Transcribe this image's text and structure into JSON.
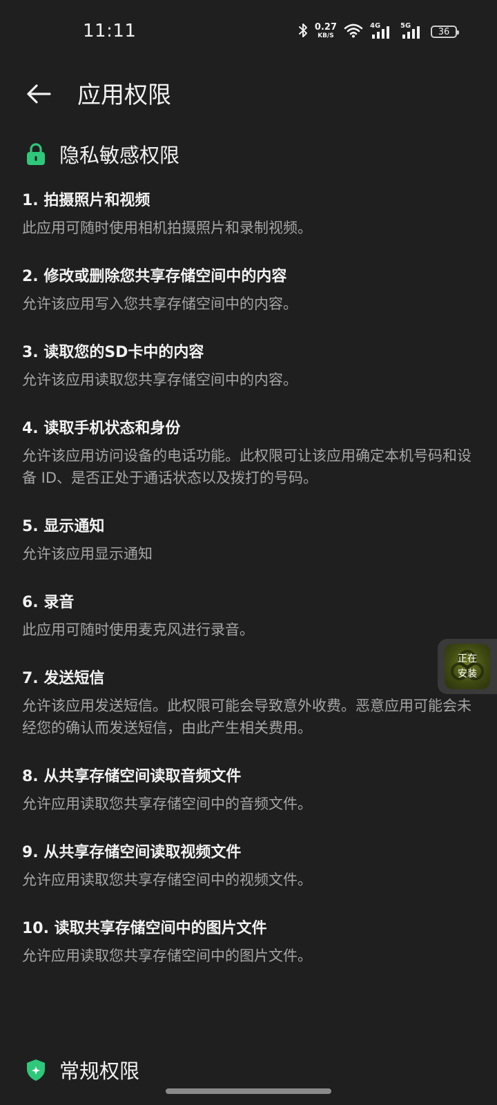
{
  "status_bar": {
    "time": "11:11",
    "net_speed_value": "0.27",
    "net_speed_unit": "KB/S",
    "signal_1_label": "4G",
    "signal_2_label": "5G",
    "battery_level": "36"
  },
  "header": {
    "title": "应用权限"
  },
  "privacy_section": {
    "title": "隐私敏感权限",
    "accent_color": "#2fc77a",
    "items": [
      {
        "title": "1. 拍摄照片和视频",
        "desc": "此应用可随时使用相机拍摄照片和录制视频。"
      },
      {
        "title": "2. 修改或删除您共享存储空间中的内容",
        "desc": "允许该应用写入您共享存储空间中的内容。"
      },
      {
        "title": "3. 读取您的SD卡中的内容",
        "desc": "允许该应用读取您共享存储空间中的内容。"
      },
      {
        "title": "4. 读取手机状态和身份",
        "desc": "允许该应用访问设备的电话功能。此权限可让该应用确定本机号码和设备 ID、是否正处于通话状态以及拨打的号码。"
      },
      {
        "title": "5. 显示通知",
        "desc": "允许该应用显示通知"
      },
      {
        "title": "6. 录音",
        "desc": "此应用可随时使用麦克风进行录音。"
      },
      {
        "title": "7. 发送短信",
        "desc": "允许该应用发送短信。此权限可能会导致意外收费。恶意应用可能会未经您的确认而发送短信，由此产生相关费用。"
      },
      {
        "title": "8. 从共享存储空间读取音频文件",
        "desc": "允许应用读取您共享存储空间中的音频文件。"
      },
      {
        "title": "9. 从共享存储空间读取视频文件",
        "desc": "允许应用读取您共享存储空间中的视频文件。"
      },
      {
        "title": "10. 读取共享存储空间中的图片文件",
        "desc": "允许应用读取您共享存储空间中的图片文件。"
      }
    ]
  },
  "general_section": {
    "title": "常规权限"
  },
  "install_float": {
    "label": "正在安装"
  },
  "icons": {
    "back": "arrow-left-icon",
    "lock": "lock-icon",
    "shield": "shield-icon",
    "bluetooth": "bluetooth-icon",
    "wifi": "wifi-icon",
    "battery": "battery-icon"
  }
}
